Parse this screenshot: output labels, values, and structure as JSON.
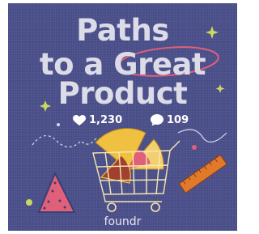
{
  "post": {
    "title_lines": [
      "Paths",
      "to a Great",
      "Product"
    ],
    "likes": "1,230",
    "comments": "109",
    "brand": "foundr"
  },
  "icons": {
    "like": "heart-icon",
    "comment": "comment-bubble-icon"
  },
  "colors": {
    "background": "#4b4f8a",
    "title": "#dcdce8",
    "accent_pink": "#e0607a",
    "accent_yellow": "#f0c040",
    "accent_orange": "#e07a2a"
  }
}
